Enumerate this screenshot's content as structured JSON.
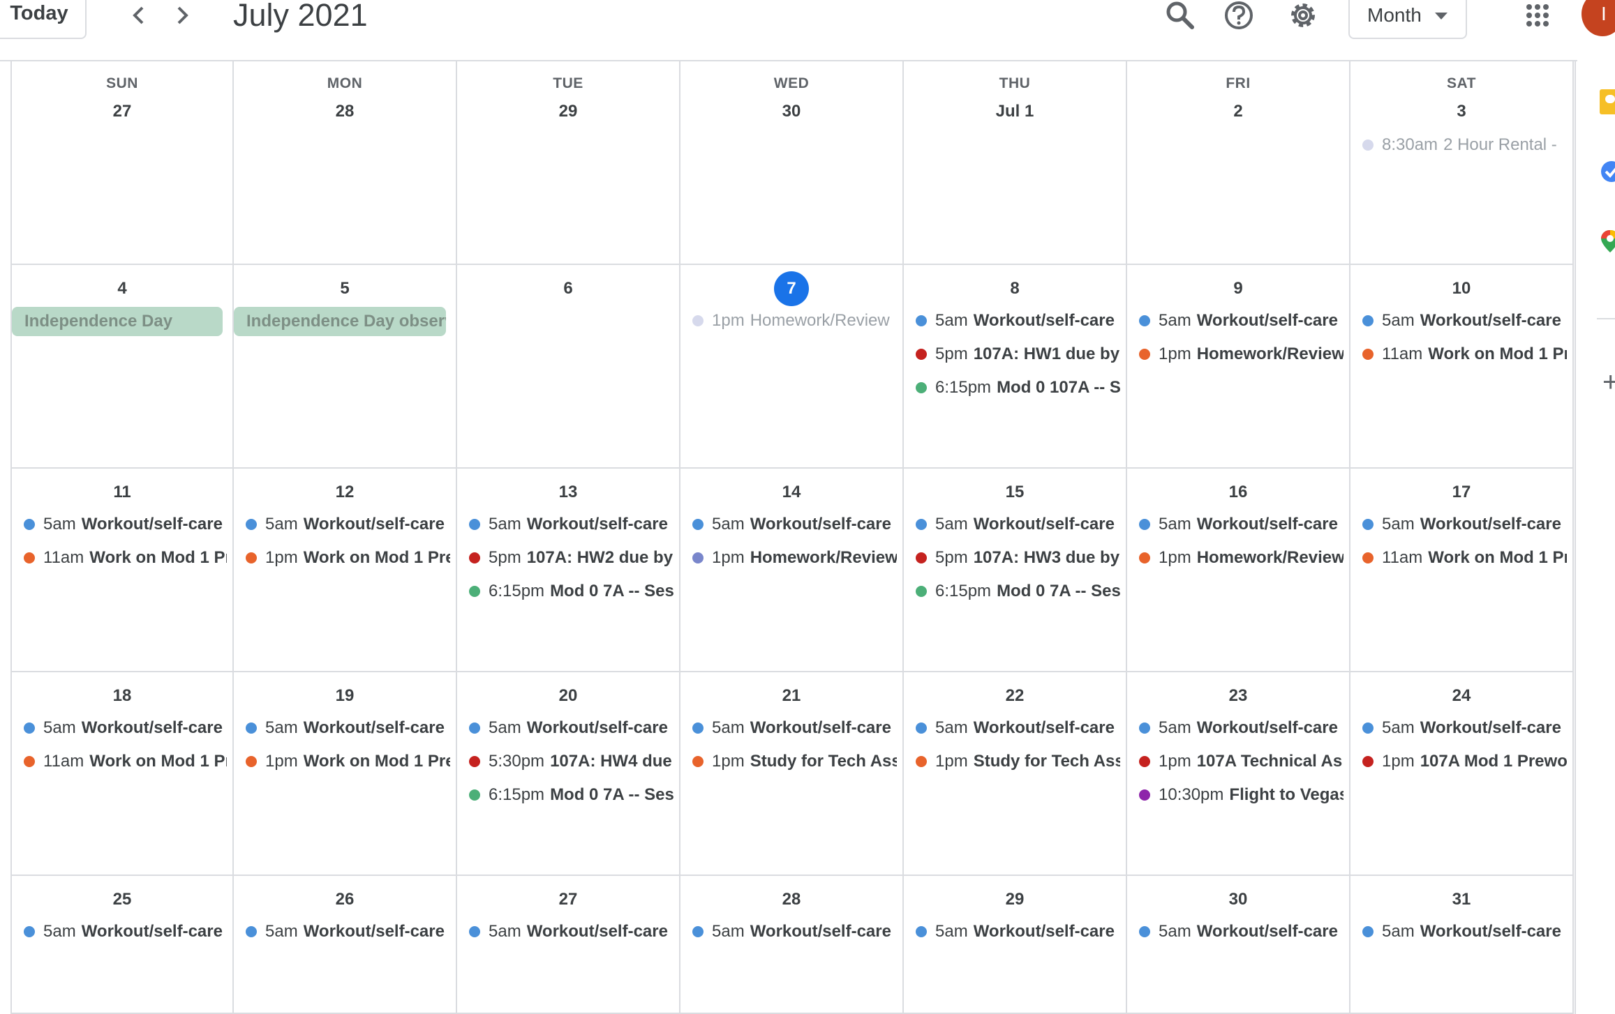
{
  "header": {
    "today_label": "Today",
    "title": "July 2021",
    "view_label": "Month",
    "avatar_initial": "I",
    "icons": [
      "search-icon",
      "help-icon",
      "settings-icon",
      "apps-grid-icon"
    ]
  },
  "colors": {
    "blue": "#4a90d9",
    "orange": "#e8632b",
    "red": "#c5221f",
    "green": "#4caf78",
    "lavender": "#7986cb",
    "purple": "#8e24aa",
    "faded": "#d6d9ec",
    "today": "#1a73e8",
    "holiday": "#b9d9c8"
  },
  "weekdays": [
    "SUN",
    "MON",
    "TUE",
    "WED",
    "THU",
    "FRI",
    "SAT"
  ],
  "weeks": [
    {
      "days": [
        {
          "label": "27",
          "events": []
        },
        {
          "label": "28",
          "events": []
        },
        {
          "label": "29",
          "events": []
        },
        {
          "label": "30",
          "events": []
        },
        {
          "label": "Jul 1",
          "events": []
        },
        {
          "label": "2",
          "events": []
        },
        {
          "label": "3",
          "events": [
            {
              "time": "8:30am",
              "title": "2 Hour Rental -",
              "color": "faded",
              "past": true
            }
          ]
        }
      ]
    },
    {
      "days": [
        {
          "label": "4",
          "allday": "Independence Day",
          "events": []
        },
        {
          "label": "5",
          "allday": "Independence Day observed",
          "events": []
        },
        {
          "label": "6",
          "events": []
        },
        {
          "label": "7",
          "today": true,
          "events": [
            {
              "time": "1pm",
              "title": "Homework/Review",
              "color": "faded",
              "past": true
            }
          ]
        },
        {
          "label": "8",
          "events": [
            {
              "time": "5am",
              "title": "Workout/self-care",
              "color": "blue"
            },
            {
              "time": "5pm",
              "title": "107A: HW1 due by",
              "color": "red"
            },
            {
              "time": "6:15pm",
              "title": "Mod 0 107A -- S",
              "color": "green"
            }
          ]
        },
        {
          "label": "9",
          "events": [
            {
              "time": "5am",
              "title": "Workout/self-care",
              "color": "blue"
            },
            {
              "time": "1pm",
              "title": "Homework/Review",
              "color": "orange"
            }
          ]
        },
        {
          "label": "10",
          "events": [
            {
              "time": "5am",
              "title": "Workout/self-care",
              "color": "blue"
            },
            {
              "time": "11am",
              "title": "Work on Mod 1 Pr",
              "color": "orange"
            }
          ]
        }
      ]
    },
    {
      "days": [
        {
          "label": "11",
          "events": [
            {
              "time": "5am",
              "title": "Workout/self-care",
              "color": "blue"
            },
            {
              "time": "11am",
              "title": "Work on Mod 1 Pr",
              "color": "orange"
            }
          ]
        },
        {
          "label": "12",
          "events": [
            {
              "time": "5am",
              "title": "Workout/self-care",
              "color": "blue"
            },
            {
              "time": "1pm",
              "title": "Work on Mod 1 Pre",
              "color": "orange"
            }
          ]
        },
        {
          "label": "13",
          "events": [
            {
              "time": "5am",
              "title": "Workout/self-care",
              "color": "blue"
            },
            {
              "time": "5pm",
              "title": "107A: HW2 due by",
              "color": "red"
            },
            {
              "time": "6:15pm",
              "title": "Mod 0 7A -- Ses",
              "color": "green"
            }
          ]
        },
        {
          "label": "14",
          "events": [
            {
              "time": "5am",
              "title": "Workout/self-care",
              "color": "blue"
            },
            {
              "time": "1pm",
              "title": "Homework/Review",
              "color": "lavender"
            }
          ]
        },
        {
          "label": "15",
          "events": [
            {
              "time": "5am",
              "title": "Workout/self-care",
              "color": "blue"
            },
            {
              "time": "5pm",
              "title": "107A: HW3 due by",
              "color": "red"
            },
            {
              "time": "6:15pm",
              "title": "Mod 0 7A -- Ses",
              "color": "green"
            }
          ]
        },
        {
          "label": "16",
          "events": [
            {
              "time": "5am",
              "title": "Workout/self-care",
              "color": "blue"
            },
            {
              "time": "1pm",
              "title": "Homework/Review",
              "color": "orange"
            }
          ]
        },
        {
          "label": "17",
          "events": [
            {
              "time": "5am",
              "title": "Workout/self-care",
              "color": "blue"
            },
            {
              "time": "11am",
              "title": "Work on Mod 1 Pr",
              "color": "orange"
            }
          ]
        }
      ]
    },
    {
      "days": [
        {
          "label": "18",
          "events": [
            {
              "time": "5am",
              "title": "Workout/self-care",
              "color": "blue"
            },
            {
              "time": "11am",
              "title": "Work on Mod 1 Pr",
              "color": "orange"
            }
          ]
        },
        {
          "label": "19",
          "events": [
            {
              "time": "5am",
              "title": "Workout/self-care",
              "color": "blue"
            },
            {
              "time": "1pm",
              "title": "Work on Mod 1 Pre",
              "color": "orange"
            }
          ]
        },
        {
          "label": "20",
          "events": [
            {
              "time": "5am",
              "title": "Workout/self-care",
              "color": "blue"
            },
            {
              "time": "5:30pm",
              "title": "107A: HW4 due",
              "color": "red"
            },
            {
              "time": "6:15pm",
              "title": "Mod 0 7A -- Ses",
              "color": "green"
            }
          ]
        },
        {
          "label": "21",
          "events": [
            {
              "time": "5am",
              "title": "Workout/self-care",
              "color": "blue"
            },
            {
              "time": "1pm",
              "title": "Study for Tech Ass",
              "color": "orange"
            }
          ]
        },
        {
          "label": "22",
          "events": [
            {
              "time": "5am",
              "title": "Workout/self-care",
              "color": "blue"
            },
            {
              "time": "1pm",
              "title": "Study for Tech Ass",
              "color": "orange"
            }
          ]
        },
        {
          "label": "23",
          "events": [
            {
              "time": "5am",
              "title": "Workout/self-care",
              "color": "blue"
            },
            {
              "time": "1pm",
              "title": "107A Technical As",
              "color": "red"
            },
            {
              "time": "10:30pm",
              "title": "Flight to Vegas",
              "color": "purple"
            }
          ]
        },
        {
          "label": "24",
          "events": [
            {
              "time": "5am",
              "title": "Workout/self-care",
              "color": "blue"
            },
            {
              "time": "1pm",
              "title": "107A Mod 1 Prewo",
              "color": "red"
            }
          ]
        }
      ]
    },
    {
      "days": [
        {
          "label": "25",
          "events": [
            {
              "time": "5am",
              "title": "Workout/self-care",
              "color": "blue"
            }
          ]
        },
        {
          "label": "26",
          "events": [
            {
              "time": "5am",
              "title": "Workout/self-care",
              "color": "blue"
            }
          ]
        },
        {
          "label": "27",
          "events": [
            {
              "time": "5am",
              "title": "Workout/self-care",
              "color": "blue"
            }
          ]
        },
        {
          "label": "28",
          "events": [
            {
              "time": "5am",
              "title": "Workout/self-care",
              "color": "blue"
            }
          ]
        },
        {
          "label": "29",
          "events": [
            {
              "time": "5am",
              "title": "Workout/self-care",
              "color": "blue"
            }
          ]
        },
        {
          "label": "30",
          "events": [
            {
              "time": "5am",
              "title": "Workout/self-care",
              "color": "blue"
            }
          ]
        },
        {
          "label": "31",
          "events": [
            {
              "time": "5am",
              "title": "Workout/self-care",
              "color": "blue"
            }
          ]
        }
      ]
    }
  ]
}
